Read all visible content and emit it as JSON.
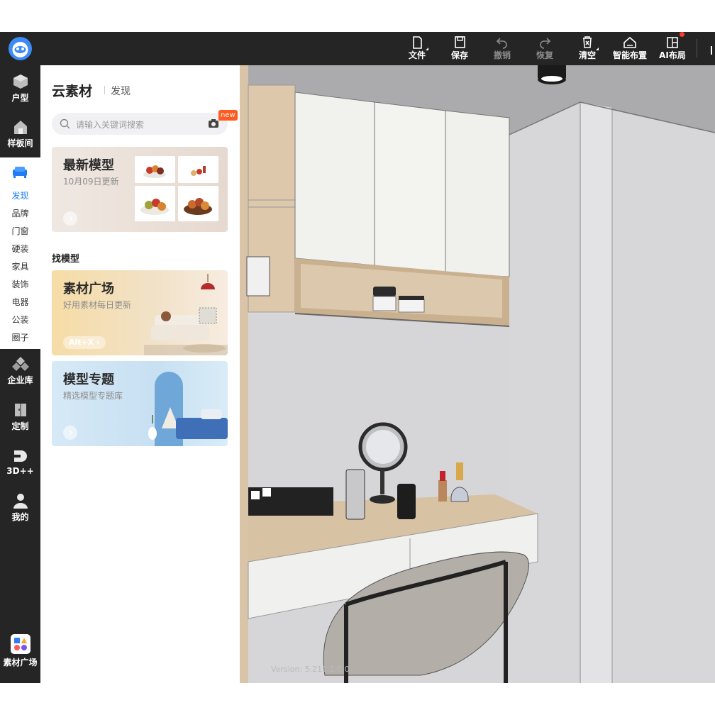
{
  "toolbar": {
    "items": [
      {
        "label": "文件",
        "icon": "file-icon"
      },
      {
        "label": "保存",
        "icon": "save-icon"
      },
      {
        "label": "撤销",
        "icon": "undo-icon",
        "disabled": true
      },
      {
        "label": "恢复",
        "icon": "redo-icon",
        "disabled": true
      },
      {
        "label": "清空",
        "icon": "clear-icon"
      },
      {
        "label": "智能布置",
        "icon": "smart-layout-icon"
      },
      {
        "label": "AI布局",
        "icon": "ai-layout-icon"
      }
    ]
  },
  "leftnav": {
    "top": [
      {
        "label": "户型",
        "icon": "floorplan-icon"
      },
      {
        "label": "样板间",
        "icon": "showroom-icon"
      }
    ],
    "categories": [
      "发现",
      "品牌",
      "门窗",
      "硬装",
      "家具",
      "装饰",
      "电器",
      "公装",
      "圈子"
    ],
    "active_category": "发现",
    "bottom": [
      {
        "label": "企业库",
        "icon": "enterprise-icon"
      },
      {
        "label": "定制",
        "icon": "custom-icon"
      },
      {
        "label": "3D++",
        "icon": "3dplus-icon"
      },
      {
        "label": "我的",
        "icon": "user-icon"
      }
    ],
    "footer": {
      "label": "素材广场",
      "icon": "material-plaza-icon"
    }
  },
  "panel": {
    "title": "云素材",
    "subtitle": "发现",
    "search_placeholder": "请输入关键词搜索",
    "new_badge": "new",
    "latest": {
      "title": "最新模型",
      "subtitle": "10月09日更新"
    },
    "section_title": "找模型",
    "plaza": {
      "title": "素材广场",
      "subtitle": "好用素材每日更新",
      "shortcut": "Alt+X"
    },
    "topic": {
      "title": "模型专题",
      "subtitle": "精选模型专题库"
    }
  },
  "viewport": {
    "version": "Version: 5.211.2.0.0",
    "scene": "3d-render-dressing-table"
  },
  "colors": {
    "dark": "#252526",
    "accent": "#1f7cf5",
    "badge": "#ff5a1f"
  }
}
